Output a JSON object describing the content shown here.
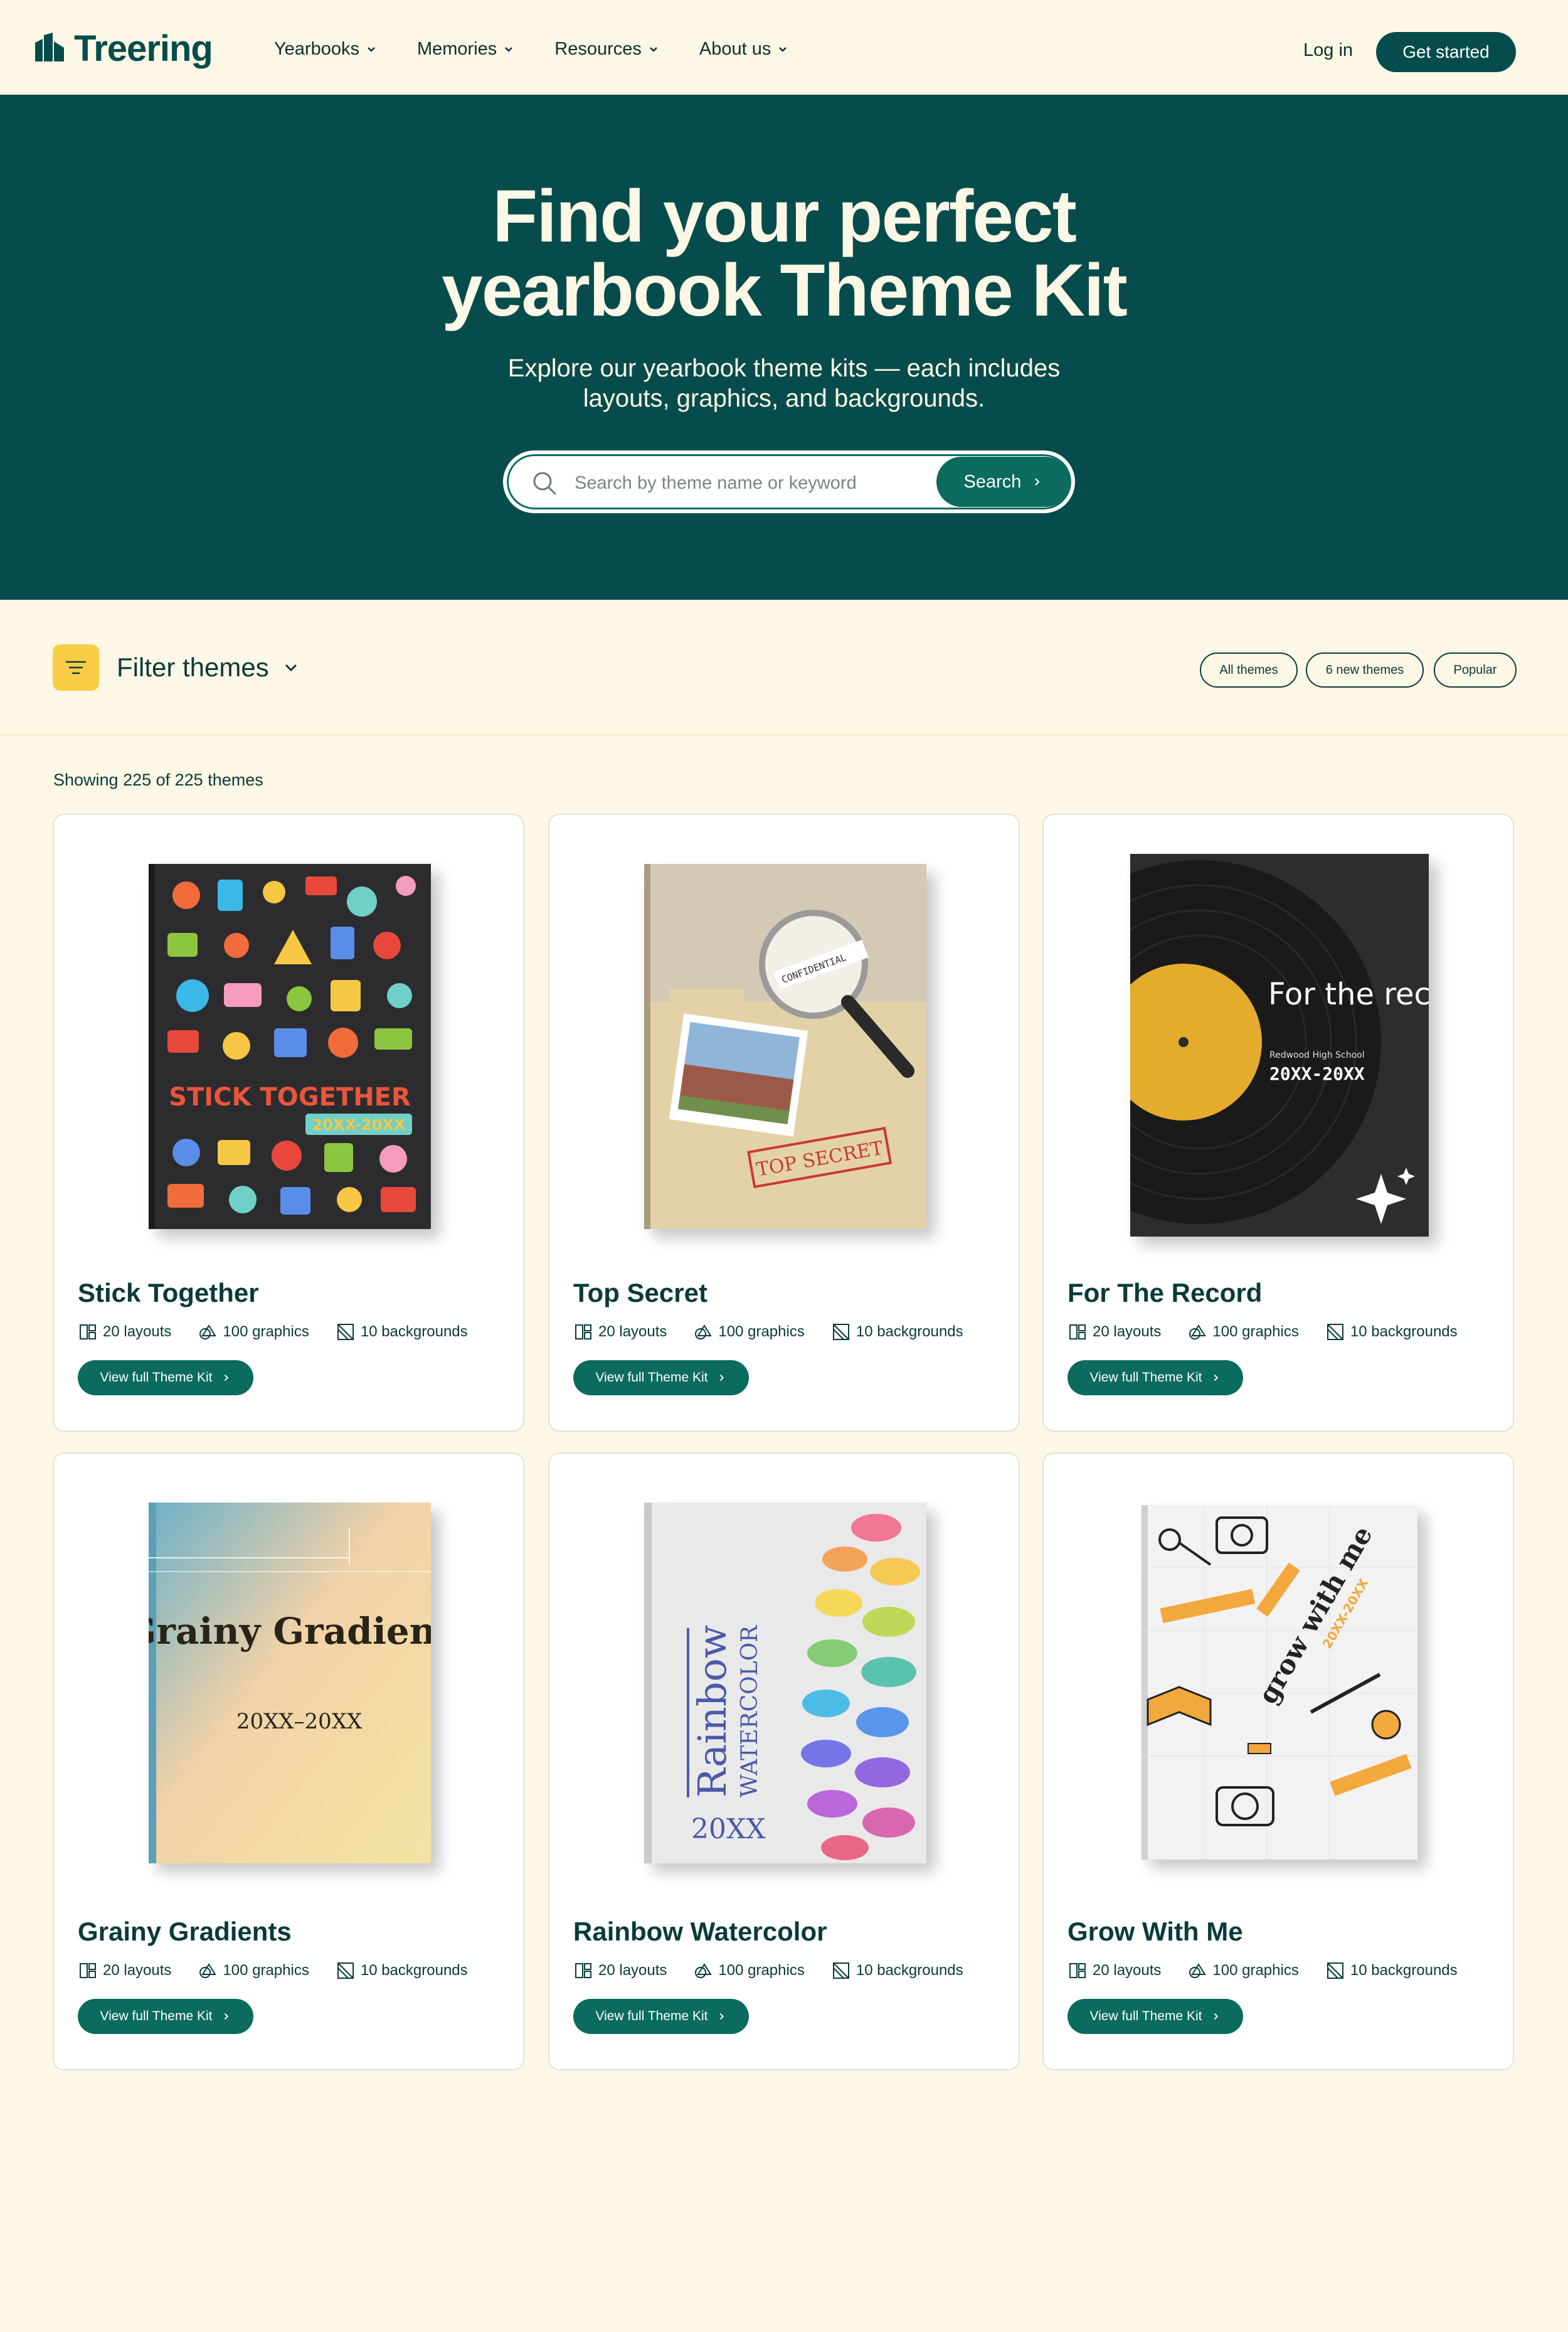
{
  "brand": {
    "name": "Treering"
  },
  "nav": {
    "links": [
      "Yearbooks",
      "Memories",
      "Resources",
      "About us"
    ],
    "login": "Log in",
    "cta": "Get started"
  },
  "hero": {
    "title_line1": "Find your perfect",
    "title_line2": "yearbook Theme Kit",
    "subtitle_line1": "Explore our yearbook theme kits — each includes",
    "subtitle_line2": "layouts, graphics, and backgrounds.",
    "search_placeholder": "Search by theme name or keyword",
    "search_button": "Search"
  },
  "filters": {
    "label": "Filter themes",
    "pills": [
      "All themes",
      "6 new themes",
      "Popular"
    ]
  },
  "results": {
    "showing": "Showing 225 of 225 themes"
  },
  "cards": [
    {
      "title": "Stick Together",
      "layouts": "20 layouts",
      "graphics": "100 graphics",
      "backgrounds": "10 backgrounds",
      "button": "View full Theme Kit",
      "cover_text": "STICK TOGETHER",
      "cover_sub": "20XX-20XX"
    },
    {
      "title": "Top Secret",
      "layouts": "20 layouts",
      "graphics": "100 graphics",
      "backgrounds": "10 backgrounds",
      "button": "View full Theme Kit",
      "cover_text": "TOP SECRET",
      "cover_sub": "CONFIDENTIAL"
    },
    {
      "title": "For The Record",
      "layouts": "20 layouts",
      "graphics": "100 graphics",
      "backgrounds": "10 backgrounds",
      "button": "View full Theme Kit",
      "cover_text": "For the record",
      "cover_sub": "Redwood High School",
      "cover_year": "20XX-20XX"
    },
    {
      "title": "Grainy Gradients",
      "layouts": "20 layouts",
      "graphics": "100 graphics",
      "backgrounds": "10 backgrounds",
      "button": "View full Theme Kit",
      "cover_text": "Grainy Gradients",
      "cover_sub": "20XX–20XX"
    },
    {
      "title": "Rainbow Watercolor",
      "layouts": "20 layouts",
      "graphics": "100 graphics",
      "backgrounds": "10 backgrounds",
      "button": "View full Theme Kit",
      "cover_text": "Rainbow",
      "cover_sub": "WATERCOLOR",
      "cover_year": "20XX"
    },
    {
      "title": "Grow With Me",
      "layouts": "20 layouts",
      "graphics": "100 graphics",
      "backgrounds": "10 backgrounds",
      "button": "View full Theme Kit",
      "cover_text": "grow with me",
      "cover_sub": "20XX-20XX"
    }
  ],
  "colors": {
    "primary": "#074c4c",
    "accent": "#0b6b5e",
    "background": "#fdf8e6",
    "filter_icon": "#f9cd46"
  }
}
